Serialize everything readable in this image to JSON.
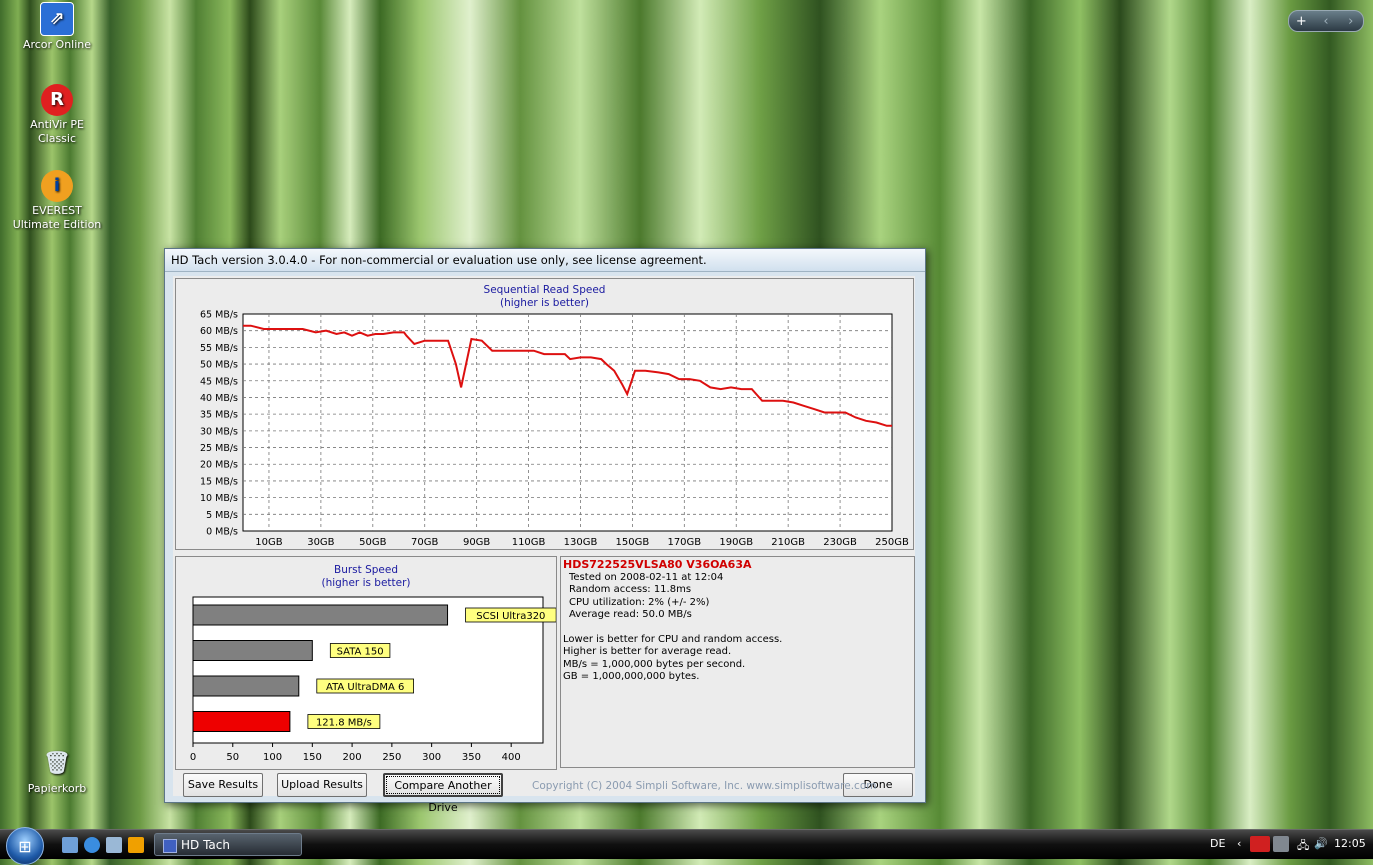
{
  "desktop": {
    "icons": [
      {
        "label": "Arcor Online",
        "color": "#2b6fd6",
        "glyph": "⇗"
      },
      {
        "label": "AntiVir PE Classic",
        "color": "#e02020",
        "glyph": "R"
      },
      {
        "label": "EVEREST Ultimate Edition",
        "color": "#f0a020",
        "glyph": "i"
      },
      {
        "label": "Papierkorb",
        "color": "#c0d0dc",
        "glyph": "🗑"
      }
    ],
    "gadget": {
      "add": "+",
      "prev": "‹",
      "next": "›"
    }
  },
  "window": {
    "title": "HD Tach version 3.0.4.0  - For non-commercial or evaluation use only, see license agreement."
  },
  "chart_data": [
    {
      "type": "line",
      "title": "Sequential Read Speed",
      "subtitle": "(higher is better)",
      "xlabel": "",
      "ylabel": "",
      "ylim": [
        0,
        65
      ],
      "xlim": [
        0,
        250
      ],
      "y_ticks": [
        "0 MB/s",
        "5 MB/s",
        "10 MB/s",
        "15 MB/s",
        "20 MB/s",
        "25 MB/s",
        "30 MB/s",
        "35 MB/s",
        "40 MB/s",
        "45 MB/s",
        "50 MB/s",
        "55 MB/s",
        "60 MB/s",
        "65 MB/s"
      ],
      "x_ticks": [
        "10GB",
        "30GB",
        "50GB",
        "70GB",
        "90GB",
        "110GB",
        "130GB",
        "150GB",
        "170GB",
        "190GB",
        "210GB",
        "230GB",
        "250GB"
      ],
      "grid": true,
      "color": "#dd1010",
      "x": [
        0,
        3,
        8,
        13,
        18,
        23,
        28,
        32,
        36,
        39,
        42,
        45,
        48,
        51,
        54,
        58,
        62,
        63,
        66,
        70,
        75,
        79,
        82,
        84,
        88,
        92,
        96,
        100,
        104,
        108,
        112,
        116,
        120,
        124,
        126,
        130,
        134,
        138,
        140,
        143,
        146,
        148,
        151,
        155,
        160,
        164,
        168,
        172,
        176,
        180,
        184,
        188,
        192,
        196,
        200,
        204,
        208,
        212,
        216,
        220,
        224,
        228,
        232,
        236,
        240,
        244,
        248,
        250
      ],
      "y": [
        61.5,
        61.5,
        60.5,
        60.5,
        60.5,
        60.5,
        59.5,
        60,
        59,
        59.5,
        58.5,
        59.5,
        58.5,
        59,
        59,
        59.5,
        59.5,
        58.5,
        56,
        57,
        57,
        57,
        50,
        43,
        57.5,
        57,
        54,
        54,
        54,
        54,
        54,
        53,
        53,
        53,
        51.5,
        52,
        52,
        51.5,
        50,
        48,
        44,
        41,
        48,
        48,
        47.5,
        47,
        45.5,
        45.5,
        45,
        43,
        42.5,
        43,
        42.5,
        42.5,
        39,
        39,
        39,
        38.5,
        37.5,
        36.5,
        35.5,
        35.5,
        35.5,
        34,
        33,
        32.5,
        31.5,
        31.5
      ]
    },
    {
      "type": "bar",
      "title": "Burst Speed",
      "subtitle": "(higher is better)",
      "xlabel": "",
      "ylabel": "",
      "xlim": [
        0,
        440
      ],
      "x_ticks": [
        0,
        50,
        100,
        150,
        200,
        250,
        300,
        350,
        400
      ],
      "categories": [
        "SCSI Ultra320",
        "SATA 150",
        "ATA UltraDMA 6",
        "121.8 MB/s"
      ],
      "values": [
        320,
        150,
        133,
        121.8
      ],
      "colors": [
        "#808080",
        "#808080",
        "#808080",
        "#ee0000"
      ]
    }
  ],
  "info": {
    "drive": "HDS722525VLSA80 V36OA63A",
    "tested_on": "Tested on 2008-02-11 at 12:04",
    "random_access": "Random access: 11.8ms",
    "cpu": "CPU utilization: 2% (+/- 2%)",
    "avg_read": "Average read: 50.0 MB/s",
    "note1": "Lower is better for CPU and random access.",
    "note2": "Higher is better for average read.",
    "note3": "MB/s = 1,000,000 bytes per second.",
    "note4": "GB = 1,000,000,000 bytes."
  },
  "buttons": {
    "save": "Save Results",
    "upload": "Upload Results",
    "compare": "Compare Another Drive",
    "done": "Done"
  },
  "copyright": "Copyright (C) 2004 Simpli Software, Inc. www.simplisoftware.com",
  "taskbar": {
    "task": "HD Tach",
    "lang": "DE",
    "clock": "12:05"
  }
}
